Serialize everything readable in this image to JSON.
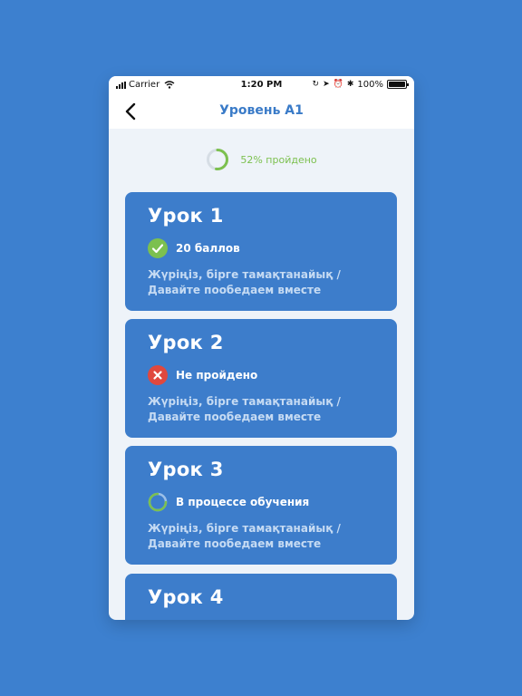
{
  "status_bar": {
    "carrier": "Carrier",
    "time": "1:20 PM",
    "battery": "100%"
  },
  "nav": {
    "title": "Уровень А1"
  },
  "progress": {
    "percent": 52,
    "label": "52% пройдено"
  },
  "lessons": [
    {
      "title": "Урок 1",
      "status": "completed",
      "status_text": "20 баллов",
      "desc_line1": "Жүріңіз, бірге тамақтанайық /",
      "desc_line2": "Давайте пообедаем вместе"
    },
    {
      "title": "Урок 2",
      "status": "failed",
      "status_text": "Не пройдено",
      "desc_line1": "Жүріңіз, бірге тамақтанайық /",
      "desc_line2": "Давайте пообедаем вместе"
    },
    {
      "title": "Урок 3",
      "status": "in-progress",
      "status_text": "В процессе обучения",
      "desc_line1": "Жүріңіз, бірге тамақтанайық /",
      "desc_line2": "Давайте пообедаем вместе"
    },
    {
      "title": "Урок 4"
    }
  ],
  "colors": {
    "background": "#3d80cf",
    "card": "#3d7dcb",
    "accent_blue": "#3a7bc8",
    "success_green": "#7cc04f",
    "error_red": "#e0483e"
  },
  "icons": {
    "back": "chevron-left-icon",
    "completed": "check-circle-icon",
    "failed": "x-circle-icon",
    "in_progress": "progress-ring-icon"
  }
}
